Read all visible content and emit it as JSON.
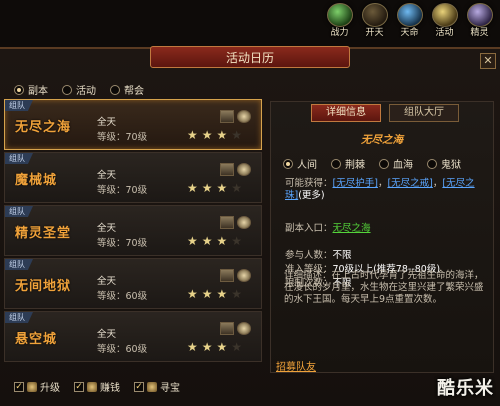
{
  "topbar": [
    {
      "label": "战力",
      "icon": "power-icon"
    },
    {
      "label": "开天",
      "icon": "sky-icon"
    },
    {
      "label": "天命",
      "icon": "destiny-icon"
    },
    {
      "label": "活动",
      "icon": "activity-icon"
    },
    {
      "label": "精灵",
      "icon": "spirit-icon"
    }
  ],
  "window": {
    "title": "活动日历",
    "close": "✕"
  },
  "tabs": [
    {
      "label": "副本",
      "selected": true
    },
    {
      "label": "活动",
      "selected": false
    },
    {
      "label": "帮会",
      "selected": false
    }
  ],
  "cards": [
    {
      "badge": "组队",
      "title": "无尽之海",
      "time": "全天",
      "level": "等级：70级",
      "stars": 3,
      "max_stars": 4,
      "selected": true
    },
    {
      "badge": "组队",
      "title": "魔械城",
      "time": "全天",
      "level": "等级：70级",
      "stars": 3,
      "max_stars": 4,
      "selected": false
    },
    {
      "badge": "组队",
      "title": "精灵圣堂",
      "time": "全天",
      "level": "等级：70级",
      "stars": 3,
      "max_stars": 4,
      "selected": false
    },
    {
      "badge": "组队",
      "title": "无间地狱",
      "time": "全天",
      "level": "等级：60级",
      "stars": 3,
      "max_stars": 4,
      "selected": false
    },
    {
      "badge": "组队",
      "title": "悬空城",
      "time": "全天",
      "level": "等级：60级",
      "stars": 3,
      "max_stars": 4,
      "selected": false
    }
  ],
  "filters": [
    {
      "label": "升级",
      "checked": true
    },
    {
      "label": "赚钱",
      "checked": true
    },
    {
      "label": "寻宝",
      "checked": true
    }
  ],
  "detail": {
    "tabs": [
      {
        "label": "详细信息",
        "active": true
      },
      {
        "label": "组队大厅",
        "active": false
      }
    ],
    "name": "无尽之海",
    "difficulties": [
      {
        "label": "人间",
        "selected": true
      },
      {
        "label": "荆棘",
        "selected": false
      },
      {
        "label": "血海",
        "selected": false
      },
      {
        "label": "鬼狱",
        "selected": false
      }
    ],
    "rewards_label": "可能获得：",
    "rewards": [
      "[无尽护手]",
      "[无尽之戒]",
      "[无尽之珠]"
    ],
    "more": "(更多)",
    "entrance_label": "副本入口：",
    "entrance": "无尽之海",
    "participants_label": "参与人数：",
    "participants": "不限",
    "entry_level_label": "准入等级：",
    "entry_level": "70级以上(推荐78--80级)",
    "limit_label": "限制次数：",
    "limit": "不限",
    "desc": "详细描述：在上古时代孕育了先祖生命的海洋，在漫长的岁月里，水生物在这里兴建了繁荣兴盛的水下王国。每天早上9点重置次数。",
    "recruit": "招募队友"
  },
  "watermark": "酷乐米"
}
